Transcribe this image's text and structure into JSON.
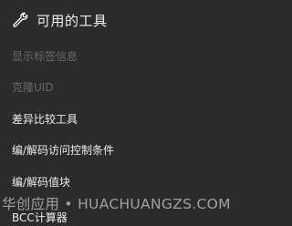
{
  "header": {
    "icon": "wrench-icon",
    "title": "可用的工具"
  },
  "menu": {
    "items": [
      {
        "label": "显示标签信息",
        "enabled": false
      },
      {
        "label": "克隆UID",
        "enabled": false
      },
      {
        "label": "差异比较工具",
        "enabled": true
      },
      {
        "label": "编/解码访问控制条件",
        "enabled": true
      },
      {
        "label": "编/解码值块",
        "enabled": true
      }
    ],
    "partial_item": "BCC计算器"
  },
  "watermark": "华创应用 • HUACHUANGZS.COM",
  "colors": {
    "background": "#2b2b2b",
    "text": "#ededed",
    "disabled_text": "#6a6a6a"
  }
}
